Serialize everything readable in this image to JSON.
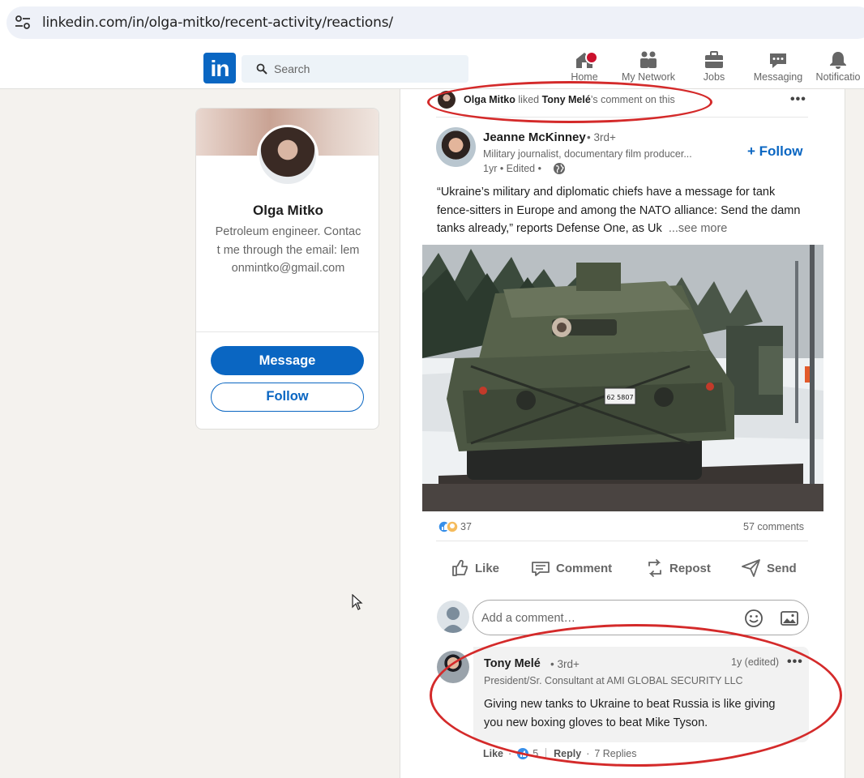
{
  "browser": {
    "url": "linkedin.com/in/olga-mitko/recent-activity/reactions/"
  },
  "nav": {
    "logo_text": "in",
    "search_placeholder": "Search",
    "items": [
      {
        "label": "Home",
        "icon": "home-icon"
      },
      {
        "label": "My Network",
        "icon": "network-icon"
      },
      {
        "label": "Jobs",
        "icon": "briefcase-icon"
      },
      {
        "label": "Messaging",
        "icon": "messaging-icon"
      },
      {
        "label": "Notificatio",
        "icon": "bell-icon"
      }
    ]
  },
  "profile": {
    "name": "Olga Mitko",
    "bio": "Petroleum engineer. Contact me through the email: lemonmintko@gmail.com",
    "message_label": "Message",
    "follow_label": "Follow"
  },
  "activity": {
    "actor": "Olga Mitko",
    "verb": "liked",
    "target": "Tony Melé",
    "suffix": "’s comment on this"
  },
  "post": {
    "author": {
      "name": "Jeanne McKinney",
      "degree": "• 3rd+",
      "headline": "Military journalist, documentary film producer...",
      "time": "1yr • Edited •"
    },
    "follow_label": "+ Follow",
    "text": "“Ukraine’s military and diplomatic chiefs have a message for tank fence-sitters in Europe and among the NATO alliance: Send the damn tanks already,” reports Defense One, as Uk",
    "see_more": "...see more",
    "image_plate": "62 5807",
    "reactions_count": "37",
    "comments_count": "57 comments",
    "actions": {
      "like": "Like",
      "comment": "Comment",
      "repost": "Repost",
      "send": "Send"
    }
  },
  "comment_box": {
    "placeholder": "Add a comment…"
  },
  "comment": {
    "name": "Tony Melé",
    "degree": "• 3rd+",
    "time": "1y (edited)",
    "headline": "President/Sr. Consultant at AMI GLOBAL SECURITY LLC",
    "text": "Giving new tanks to Ukraine to beat Russia is like giving you new boxing gloves to beat Mike Tyson.",
    "like_label": "Like",
    "like_count": "5",
    "reply_label": "Reply",
    "replies_label": "7 Replies"
  },
  "colors": {
    "brand": "#0a66c2",
    "annotation": "#d42a2a",
    "badge": "#cb112d"
  }
}
